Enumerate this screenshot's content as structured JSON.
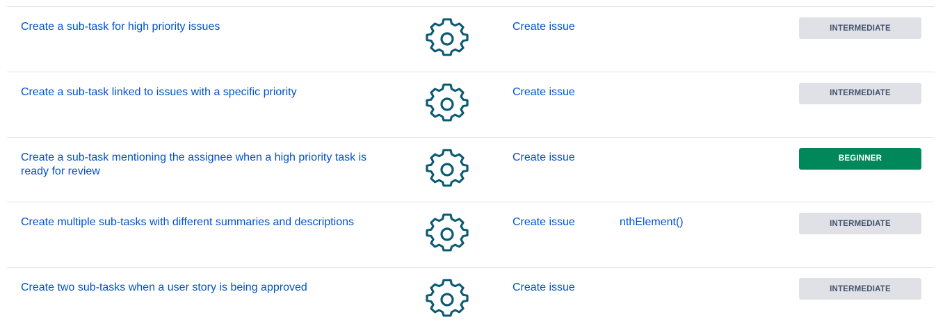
{
  "colors": {
    "link": "#0052cc",
    "gear_icon": "#0b5a73",
    "badge_gray": "#dfe1e6",
    "badge_green": "#00875a"
  },
  "rows": [
    {
      "title": "Create a sub-task for high priority issues",
      "action": "Create issue",
      "function": "",
      "level": "INTERMEDIATE",
      "icon": "gear-icon"
    },
    {
      "title": "Create a sub-task linked to issues with a specific priority",
      "action": "Create issue",
      "function": "",
      "level": "INTERMEDIATE",
      "icon": "gear-icon"
    },
    {
      "title": "Create a sub-task mentioning the assignee when a high priority task is ready for review",
      "action": "Create issue",
      "function": "",
      "level": "BEGINNER",
      "icon": "gear-icon"
    },
    {
      "title": "Create multiple sub-tasks with different summaries and descriptions",
      "action": "Create issue",
      "function": "nthElement()",
      "level": "INTERMEDIATE",
      "icon": "gear-icon"
    },
    {
      "title": "Create two sub-tasks when a user story is being approved",
      "action": "Create issue",
      "function": "",
      "level": "INTERMEDIATE",
      "icon": "gear-icon"
    }
  ]
}
